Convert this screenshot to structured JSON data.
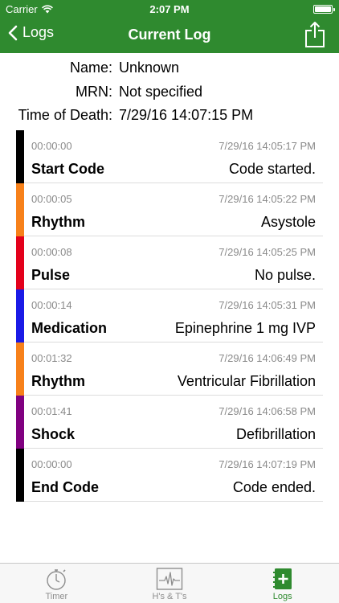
{
  "status_bar": {
    "carrier": "Carrier",
    "time": "2:07 PM"
  },
  "navbar": {
    "back_label": "Logs",
    "title": "Current Log"
  },
  "info": {
    "name_label": "Name:",
    "name_value": "Unknown",
    "mrn_label": "MRN:",
    "mrn_value": "Not specified",
    "tod_label": "Time of Death:",
    "tod_value": "7/29/16 14:07:15 PM"
  },
  "entries": [
    {
      "elapsed": "00:00:00",
      "timestamp": "7/29/16 14:05:17 PM",
      "event": "Start Code",
      "detail": "Code started.",
      "color": "#000000"
    },
    {
      "elapsed": "00:00:05",
      "timestamp": "7/29/16 14:05:22 PM",
      "event": "Rhythm",
      "detail": "Asystole",
      "color": "#f7811a"
    },
    {
      "elapsed": "00:00:08",
      "timestamp": "7/29/16 14:05:25 PM",
      "event": "Pulse",
      "detail": "No pulse.",
      "color": "#e3001b"
    },
    {
      "elapsed": "00:00:14",
      "timestamp": "7/29/16 14:05:31 PM",
      "event": "Medication",
      "detail": "Epinephrine 1 mg IVP",
      "color": "#1a1ae6"
    },
    {
      "elapsed": "00:01:32",
      "timestamp": "7/29/16 14:06:49 PM",
      "event": "Rhythm",
      "detail": "Ventricular Fibrillation",
      "color": "#f7811a"
    },
    {
      "elapsed": "00:01:41",
      "timestamp": "7/29/16 14:06:58 PM",
      "event": "Shock",
      "detail": "Defibrillation",
      "color": "#800080"
    },
    {
      "elapsed": "00:00:00",
      "timestamp": "7/29/16 14:07:19 PM",
      "event": "End Code",
      "detail": "Code ended.",
      "color": "#000000"
    }
  ],
  "tabs": [
    {
      "label": "Timer",
      "icon": "stopwatch-icon",
      "active": false
    },
    {
      "label": "H's & T's",
      "icon": "ecg-monitor-icon",
      "active": false
    },
    {
      "label": "Logs",
      "icon": "logbook-icon",
      "active": true
    }
  ],
  "colors": {
    "brand_green": "#2f8a2f",
    "inactive_gray": "#8e8e8e"
  }
}
